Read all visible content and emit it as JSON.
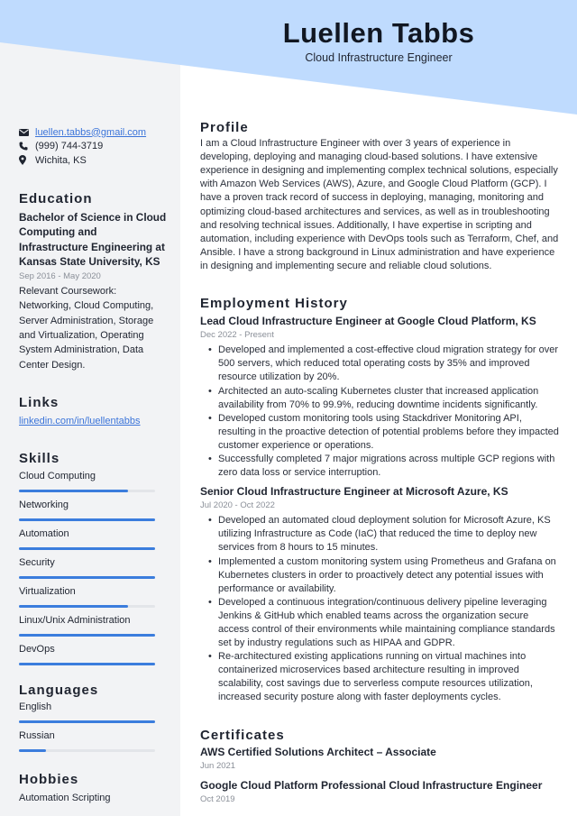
{
  "header": {
    "name": "Luellen Tabbs",
    "title": "Cloud Infrastructure Engineer",
    "accent_color": "#bfdbfe"
  },
  "contact": {
    "email": "luellen.tabbs@gmail.com",
    "phone": "(999) 744-3719",
    "location": "Wichita, KS",
    "icons": [
      "envelope-icon",
      "phone-icon",
      "map-pin-icon"
    ]
  },
  "education": {
    "heading": "Education",
    "degree": "Bachelor of Science in Cloud Computing and Infrastructure Engineering at Kansas State University, KS",
    "dates": "Sep 2016 - May 2020",
    "details": "Relevant Coursework: Networking, Cloud Computing, Server Administration, Storage and Virtualization, Operating System Administration, Data Center Design."
  },
  "links": {
    "heading": "Links",
    "items": [
      "linkedin.com/in/luellentabbs"
    ]
  },
  "skills": {
    "heading": "Skills",
    "bar_color": "#3b7ddd",
    "items": [
      {
        "label": "Cloud Computing",
        "level": 0.8
      },
      {
        "label": "Networking",
        "level": 1.0
      },
      {
        "label": "Automation",
        "level": 1.0
      },
      {
        "label": "Security",
        "level": 1.0
      },
      {
        "label": "Virtualization",
        "level": 0.8
      },
      {
        "label": "Linux/Unix Administration",
        "level": 1.0
      },
      {
        "label": "DevOps",
        "level": 1.0
      }
    ]
  },
  "languages": {
    "heading": "Languages",
    "items": [
      {
        "label": "English",
        "level": 1.0
      },
      {
        "label": "Russian",
        "level": 0.2
      }
    ]
  },
  "hobbies": {
    "heading": "Hobbies",
    "items": [
      "Automation Scripting"
    ]
  },
  "profile": {
    "heading": "Profile",
    "text": "I am a Cloud Infrastructure Engineer with over 3 years of experience in developing, deploying and managing cloud-based solutions. I have extensive experience in designing and implementing complex technical solutions, especially with Amazon Web Services (AWS), Azure, and Google Cloud Platform (GCP). I have a proven track record of success in deploying, managing, monitoring and optimizing cloud-based architectures and services, as well as in troubleshooting and resolving technical issues. Additionally, I have expertise in scripting and automation, including experience with DevOps tools such as Terraform, Chef, and Ansible. I have a strong background in Linux administration and have experience in designing and implementing secure and reliable cloud solutions."
  },
  "employment": {
    "heading": "Employment History",
    "jobs": [
      {
        "title": "Lead Cloud Infrastructure Engineer at Google Cloud Platform, KS",
        "dates": "Dec 2022 - Present",
        "bullets": [
          "Developed and implemented a cost-effective cloud migration strategy for over 500 servers, which reduced total operating costs by 35% and improved resource utilization by 20%.",
          "Architected an auto-scaling Kubernetes cluster that increased application availability from 70% to 99.9%, reducing downtime incidents significantly.",
          "Developed custom monitoring tools using Stackdriver Monitoring API, resulting in the proactive detection of potential problems before they impacted customer experience or operations.",
          "Successfully completed 7 major migrations across multiple GCP regions with zero data loss or service interruption."
        ]
      },
      {
        "title": "Senior Cloud Infrastructure Engineer at Microsoft Azure, KS",
        "dates": "Jul 2020 - Oct 2022",
        "bullets": [
          "Developed an automated cloud deployment solution for Microsoft Azure, KS utilizing Infrastructure as Code (IaC) that reduced the time to deploy new services from 8 hours to 15 minutes.",
          "Implemented a custom monitoring system using Prometheus and Grafana on Kubernetes clusters in order to proactively detect any potential issues with performance or availability.",
          "Developed a continuous integration/continuous delivery pipeline leveraging Jenkins & GitHub which enabled teams across the organization secure access control of their environments while maintaining compliance standards set by industry regulations such as HIPAA and GDPR.",
          "Re-architectured existing applications running on virtual machines into containerized microservices based architecture resulting in improved scalability, cost savings due to serverless compute resources utilization, increased security posture along with faster deployments cycles."
        ]
      }
    ]
  },
  "certificates": {
    "heading": "Certificates",
    "items": [
      {
        "title": "AWS Certified Solutions Architect – Associate",
        "date": "Jun 2021"
      },
      {
        "title": "Google Cloud Platform Professional Cloud Infrastructure Engineer",
        "date": "Oct 2019"
      }
    ]
  }
}
